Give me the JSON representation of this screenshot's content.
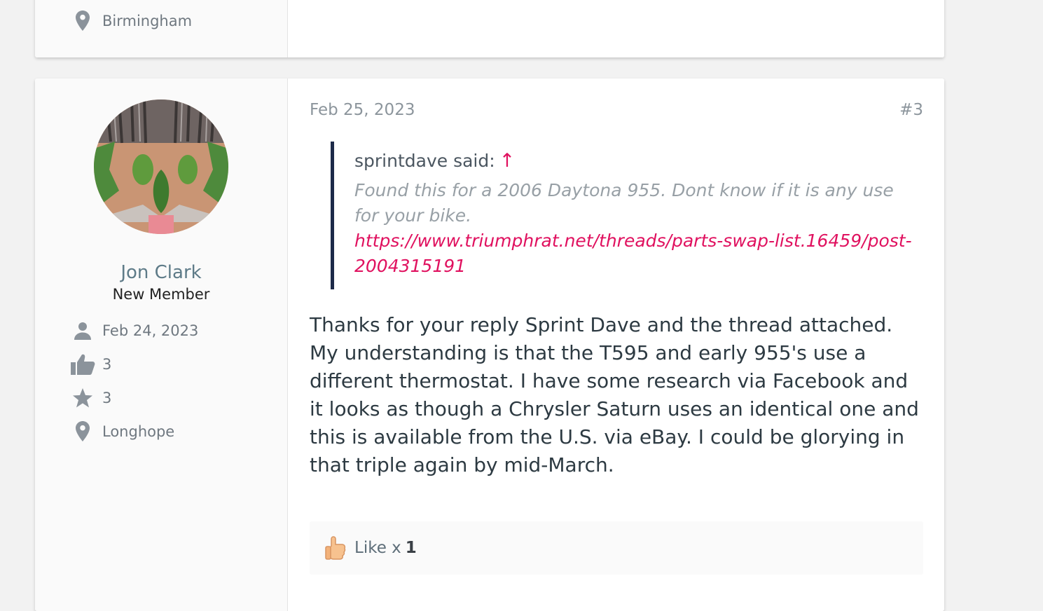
{
  "previous_post": {
    "location": "Birmingham"
  },
  "post": {
    "user": {
      "name": "Jon Clark",
      "title": "New Member",
      "joined": "Feb 24, 2023",
      "reaction_score": "3",
      "points": "3",
      "location": "Longhope"
    },
    "date": "Feb 25, 2023",
    "number": "#3",
    "quote": {
      "author_line": "sprintdave said:",
      "arrow": "↑",
      "text": "Found this for a 2006 Daytona 955. Dont know if it is any use for your bike.",
      "link": "https://www.triumphrat.net/threads/parts-swap-list.16459/post-2004315191"
    },
    "message": "Thanks for your reply Sprint Dave and the thread attached. My understanding is that the T595 and early 955's use a different thermostat. I have some research via Facebook and it looks as though a Chrysler Saturn uses an identical one and this is available from the U.S. via eBay. I could be glorying in that triple again by mid-March.",
    "reactions": {
      "label": "Like x",
      "count": "1"
    }
  },
  "icons": {
    "location": "map-marker-icon",
    "joined": "user-icon",
    "reactions": "thumbs-up-icon",
    "points": "star-icon",
    "like": "like-thumb-icon"
  },
  "colors": {
    "accent_link": "#e0115f",
    "quote_border": "#1d2a49",
    "username": "#5e7b88"
  }
}
